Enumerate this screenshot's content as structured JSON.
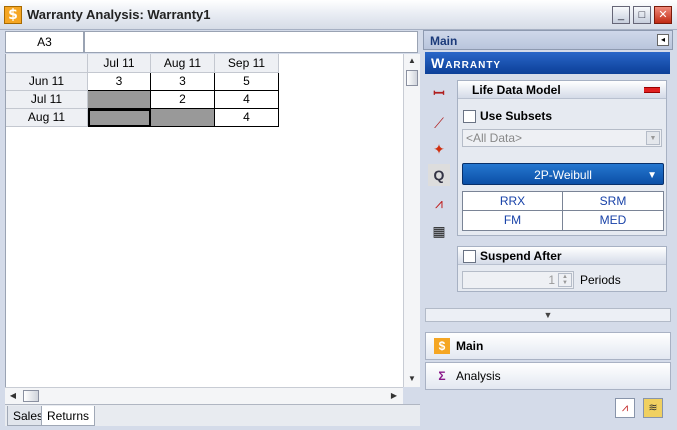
{
  "window": {
    "title": "Warranty Analysis: Warranty1",
    "app_icon": "$",
    "buttons": {
      "minimize": "_",
      "maximize": "□",
      "close": "✕"
    }
  },
  "formula_bar": {
    "cell_ref": "A3",
    "formula": ""
  },
  "sheet": {
    "col_headers": [
      "Jul 11",
      "Aug 11",
      "Sep 11"
    ],
    "rows": [
      {
        "label": "Jun 11",
        "cells": [
          "3",
          "3",
          "5"
        ]
      },
      {
        "label": "Jul 11",
        "cells": [
          "",
          "2",
          "4"
        ]
      },
      {
        "label": "Aug 11",
        "cells": [
          "",
          "",
          "4"
        ]
      }
    ]
  },
  "sheet_tabs": [
    {
      "label": "Sales",
      "active": false
    },
    {
      "label": "Returns",
      "active": true
    }
  ],
  "panel": {
    "header": "Main",
    "pin_icon": "◂",
    "banner": "Warranty",
    "tool_icons": [
      {
        "name": "data-types-icon",
        "glyph": "ꟷ"
      },
      {
        "name": "plot-line-icon",
        "glyph": "⟋"
      },
      {
        "name": "wizard-icon",
        "glyph": "✦"
      },
      {
        "name": "qcp-icon",
        "glyph": "Q"
      },
      {
        "name": "chart-icon",
        "glyph": "⩘"
      },
      {
        "name": "grid-arrows-icon",
        "glyph": "▦"
      }
    ],
    "life_data_model": {
      "title": "Life Data Model",
      "use_subsets": {
        "label": "Use Subsets",
        "checked": false
      },
      "subset_select": {
        "value": "<All Data>"
      },
      "distribution": "2P-Weibull",
      "methods": [
        "RRX",
        "SRM",
        "FM",
        "MED"
      ]
    },
    "suspend_after": {
      "label": "Suspend After",
      "checked": false,
      "value": "1",
      "unit": "Periods"
    },
    "expand_arrow": "▼",
    "nav": [
      {
        "label": "Main",
        "icon": "$",
        "bold": true
      },
      {
        "label": "Analysis",
        "icon": "Σ",
        "bold": false
      }
    ]
  }
}
